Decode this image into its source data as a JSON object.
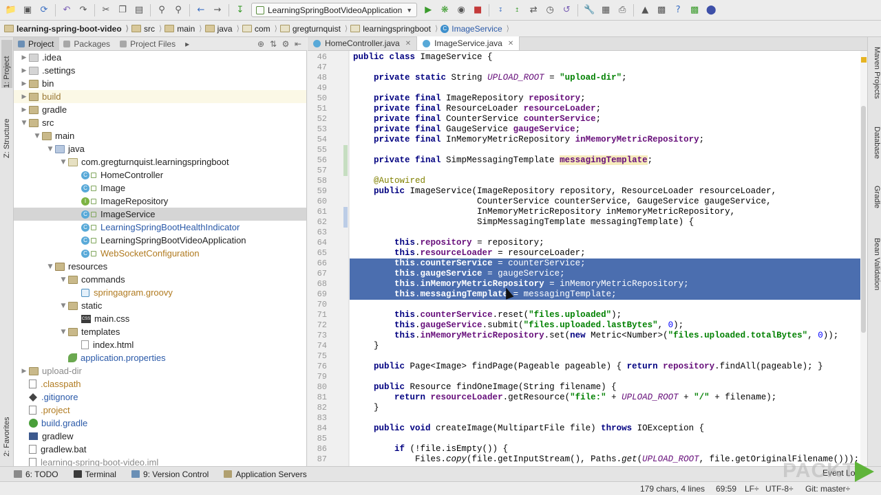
{
  "toolbar": {
    "run_config": "LearningSpringBootVideoApplication",
    "vcs_label_1": "VCS",
    "vcs_label_2": "VCS"
  },
  "breadcrumbs": [
    "learning-spring-boot-video",
    "src",
    "main",
    "java",
    "com",
    "gregturnquist",
    "learningspringboot",
    "ImageService"
  ],
  "left_stripe": {
    "project": "1: Project",
    "structure": "Z: Structure",
    "favorites": "2: Favorites"
  },
  "right_stripe": {
    "maven": "Maven Projects",
    "database": "Database",
    "gradle": "Gradle",
    "bean": "Bean Validation"
  },
  "project_panel": {
    "tabs": [
      "Project",
      "Packages",
      "Project Files"
    ],
    "tree": [
      {
        "label": ".idea",
        "depth": 1,
        "arrow": "right",
        "icon": "folder-gray",
        "color": "normal"
      },
      {
        "label": ".settings",
        "depth": 1,
        "arrow": "right",
        "icon": "folder-gray",
        "color": "normal"
      },
      {
        "label": "bin",
        "depth": 1,
        "arrow": "right",
        "icon": "folder",
        "color": "normal"
      },
      {
        "label": "build",
        "depth": 1,
        "arrow": "right",
        "icon": "folder",
        "color": "brown",
        "hl": true
      },
      {
        "label": "gradle",
        "depth": 1,
        "arrow": "right",
        "icon": "folder",
        "color": "normal"
      },
      {
        "label": "src",
        "depth": 1,
        "arrow": "down",
        "icon": "folder",
        "color": "normal"
      },
      {
        "label": "main",
        "depth": 2,
        "arrow": "down",
        "icon": "folder",
        "color": "normal"
      },
      {
        "label": "java",
        "depth": 3,
        "arrow": "down",
        "icon": "folder-src",
        "color": "normal"
      },
      {
        "label": "com.gregturnquist.learningspringboot",
        "depth": 4,
        "arrow": "down",
        "icon": "package",
        "color": "normal"
      },
      {
        "label": "HomeController",
        "depth": 5,
        "arrow": "",
        "icon": "class",
        "color": "normal"
      },
      {
        "label": "Image",
        "depth": 5,
        "arrow": "",
        "icon": "class",
        "color": "normal"
      },
      {
        "label": "ImageRepository",
        "depth": 5,
        "arrow": "",
        "icon": "interface",
        "color": "normal"
      },
      {
        "label": "ImageService",
        "depth": 5,
        "arrow": "",
        "icon": "class",
        "color": "normal",
        "sel": true
      },
      {
        "label": "LearningSpringBootHealthIndicator",
        "depth": 5,
        "arrow": "",
        "icon": "class",
        "color": "blue"
      },
      {
        "label": "LearningSpringBootVideoApplication",
        "depth": 5,
        "arrow": "",
        "icon": "class",
        "color": "normal"
      },
      {
        "label": "WebSocketConfiguration",
        "depth": 5,
        "arrow": "",
        "icon": "class",
        "color": "orange"
      },
      {
        "label": "resources",
        "depth": 3,
        "arrow": "down",
        "icon": "folder-res",
        "color": "normal"
      },
      {
        "label": "commands",
        "depth": 4,
        "arrow": "down",
        "icon": "folder",
        "color": "normal"
      },
      {
        "label": "springagram.groovy",
        "depth": 5,
        "arrow": "",
        "icon": "groovy",
        "color": "orange"
      },
      {
        "label": "static",
        "depth": 4,
        "arrow": "down",
        "icon": "folder",
        "color": "normal"
      },
      {
        "label": "main.css",
        "depth": 5,
        "arrow": "",
        "icon": "css",
        "color": "normal"
      },
      {
        "label": "templates",
        "depth": 4,
        "arrow": "down",
        "icon": "folder",
        "color": "normal"
      },
      {
        "label": "index.html",
        "depth": 5,
        "arrow": "",
        "icon": "html",
        "color": "normal"
      },
      {
        "label": "application.properties",
        "depth": 4,
        "arrow": "",
        "icon": "leaf",
        "color": "blue"
      },
      {
        "label": "upload-dir",
        "depth": 1,
        "arrow": "right",
        "icon": "folder",
        "color": "gray"
      },
      {
        "label": ".classpath",
        "depth": 1,
        "arrow": "",
        "icon": "file",
        "color": "orange"
      },
      {
        "label": ".gitignore",
        "depth": 1,
        "arrow": "",
        "icon": "git",
        "color": "blue"
      },
      {
        "label": ".project",
        "depth": 1,
        "arrow": "",
        "icon": "file",
        "color": "orange"
      },
      {
        "label": "build.gradle",
        "depth": 1,
        "arrow": "",
        "icon": "gradle",
        "color": "blue"
      },
      {
        "label": "gradlew",
        "depth": 1,
        "arrow": "",
        "icon": "terminal",
        "color": "normal"
      },
      {
        "label": "gradlew.bat",
        "depth": 1,
        "arrow": "",
        "icon": "file",
        "color": "normal"
      },
      {
        "label": "learning-spring-boot-video.iml",
        "depth": 1,
        "arrow": "",
        "icon": "file",
        "color": "gray"
      }
    ]
  },
  "editor": {
    "tabs": [
      {
        "label": "HomeController.java",
        "active": false
      },
      {
        "label": "ImageService.java",
        "active": true
      }
    ],
    "lines": [
      {
        "n": "46",
        "html": "<span class=\"kw\">public class</span> ImageService {"
      },
      {
        "n": "47",
        "html": ""
      },
      {
        "n": "48",
        "html": "    <span class=\"kw\">private static</span> String <span class=\"it\">UPLOAD_ROOT</span> = <span class=\"str\">\"upload-dir\"</span>;"
      },
      {
        "n": "49",
        "html": ""
      },
      {
        "n": "50",
        "html": "    <span class=\"kw\">private final</span> ImageRepository <span class=\"fld\">repository</span>;"
      },
      {
        "n": "51",
        "html": "    <span class=\"kw\">private final</span> ResourceLoader <span class=\"fld\">resourceLoader</span>;"
      },
      {
        "n": "52",
        "html": "    <span class=\"kw\">private final</span> CounterService <span class=\"fld\">counterService</span>;"
      },
      {
        "n": "53",
        "html": "    <span class=\"kw\">private final</span> GaugeService <span class=\"fld\">gaugeService</span>;"
      },
      {
        "n": "54",
        "html": "    <span class=\"kw\">private final</span> InMemoryMetricRepository <span class=\"fld\">inMemoryMetricRepository</span>;"
      },
      {
        "n": "55",
        "html": ""
      },
      {
        "n": "56",
        "html": "    <span class=\"kw\">private final</span> SimpMessagingTemplate <span class=\"fld hlfld\">messagingTemplate</span>;"
      },
      {
        "n": "57",
        "html": ""
      },
      {
        "n": "58",
        "html": "    <span class=\"ann\">@Autowired</span>"
      },
      {
        "n": "59",
        "html": "    <span class=\"kw\">public</span> ImageService(ImageRepository repository, ResourceLoader resourceLoader,"
      },
      {
        "n": "60",
        "html": "                        CounterService counterService, GaugeService gaugeService,"
      },
      {
        "n": "61",
        "html": "                        InMemoryMetricRepository inMemoryMetricRepository,"
      },
      {
        "n": "62",
        "html": "                        SimpMessagingTemplate messagingTemplate) {"
      },
      {
        "n": "63",
        "html": ""
      },
      {
        "n": "64",
        "html": "        <span class=\"kw\">this</span>.<span class=\"fld\">repository</span> = repository;"
      },
      {
        "n": "65",
        "html": "        <span class=\"kw\">this</span>.<span class=\"fld\">resourceLoader</span> = resourceLoader;"
      },
      {
        "n": "66",
        "html": "        <span class=\"kw\">this</span>.<span class=\"fld\">counterService</span> = counterService;",
        "sel": true
      },
      {
        "n": "67",
        "html": "        <span class=\"kw\">this</span>.<span class=\"fld\">gaugeService</span> = gaugeService;",
        "sel": true
      },
      {
        "n": "68",
        "html": "        <span class=\"kw\">this</span>.<span class=\"fld\">inMemoryMetricRepository</span> = inMemoryMetricRepository;",
        "sel": true
      },
      {
        "n": "69",
        "html": "        <span class=\"kw\">this</span>.<span class=\"fld\">messagingTemplate</span> = messagingTemplate;",
        "sel": true
      },
      {
        "n": "70",
        "html": ""
      },
      {
        "n": "71",
        "html": "        <span class=\"kw\">this</span>.<span class=\"fld\">counterService</span>.reset(<span class=\"str\">\"files.uploaded\"</span>);"
      },
      {
        "n": "72",
        "html": "        <span class=\"kw\">this</span>.<span class=\"fld\">gaugeService</span>.submit(<span class=\"str\">\"files.uploaded.lastBytes\"</span>, <span class=\"kw\" style=\"color:#0000ff;font-weight:normal\">0</span>);"
      },
      {
        "n": "73",
        "html": "        <span class=\"kw\">this</span>.<span class=\"fld\">inMemoryMetricRepository</span>.set(<span class=\"kw\">new</span> Metric&lt;Number&gt;(<span class=\"str\">\"files.uploaded.totalBytes\"</span>, <span class=\"kw\" style=\"color:#0000ff;font-weight:normal\">0</span>));"
      },
      {
        "n": "74",
        "html": "    }"
      },
      {
        "n": "75",
        "html": ""
      },
      {
        "n": "76",
        "html": "    <span class=\"kw\">public</span> Page&lt;Image&gt; findPage(Pageable pageable) { <span class=\"kw\">return</span> <span class=\"fld\">repository</span>.findAll(pageable); }"
      },
      {
        "n": "79",
        "html": ""
      },
      {
        "n": "80",
        "html": "    <span class=\"kw\">public</span> Resource findOneImage(String filename) {"
      },
      {
        "n": "81",
        "html": "        <span class=\"kw\">return</span> <span class=\"fld\">resourceLoader</span>.getResource(<span class=\"str\">\"file:\"</span> + <span class=\"it\">UPLOAD_ROOT</span> + <span class=\"str\">\"/\"</span> + filename);"
      },
      {
        "n": "82",
        "html": "    }"
      },
      {
        "n": "83",
        "html": ""
      },
      {
        "n": "84",
        "html": "    <span class=\"kw\">public void</span> createImage(MultipartFile file) <span class=\"kw\">throws</span> IOException {"
      },
      {
        "n": "85",
        "html": ""
      },
      {
        "n": "86",
        "html": "        <span class=\"kw\">if</span> (!file.isEmpty()) {"
      },
      {
        "n": "87",
        "html": "            Files.<span style=\"font-style:italic\">copy</span>(file.getInputStream(), Paths.<span style=\"font-style:italic\">get</span>(<span class=\"it\">UPLOAD_ROOT</span>, file.getOriginalFilename()));"
      }
    ]
  },
  "bottom_bar": {
    "todo": "6: TODO",
    "terminal": "Terminal",
    "vcs": "9: Version Control",
    "app_servers": "Application Servers",
    "event_log": "Event Log"
  },
  "status": {
    "selection": "179 chars, 4 lines",
    "position": "69:59",
    "line_sep": "LF÷",
    "encoding": "UTF-8÷",
    "git": "Git: master÷"
  },
  "watermark": "PACKT"
}
